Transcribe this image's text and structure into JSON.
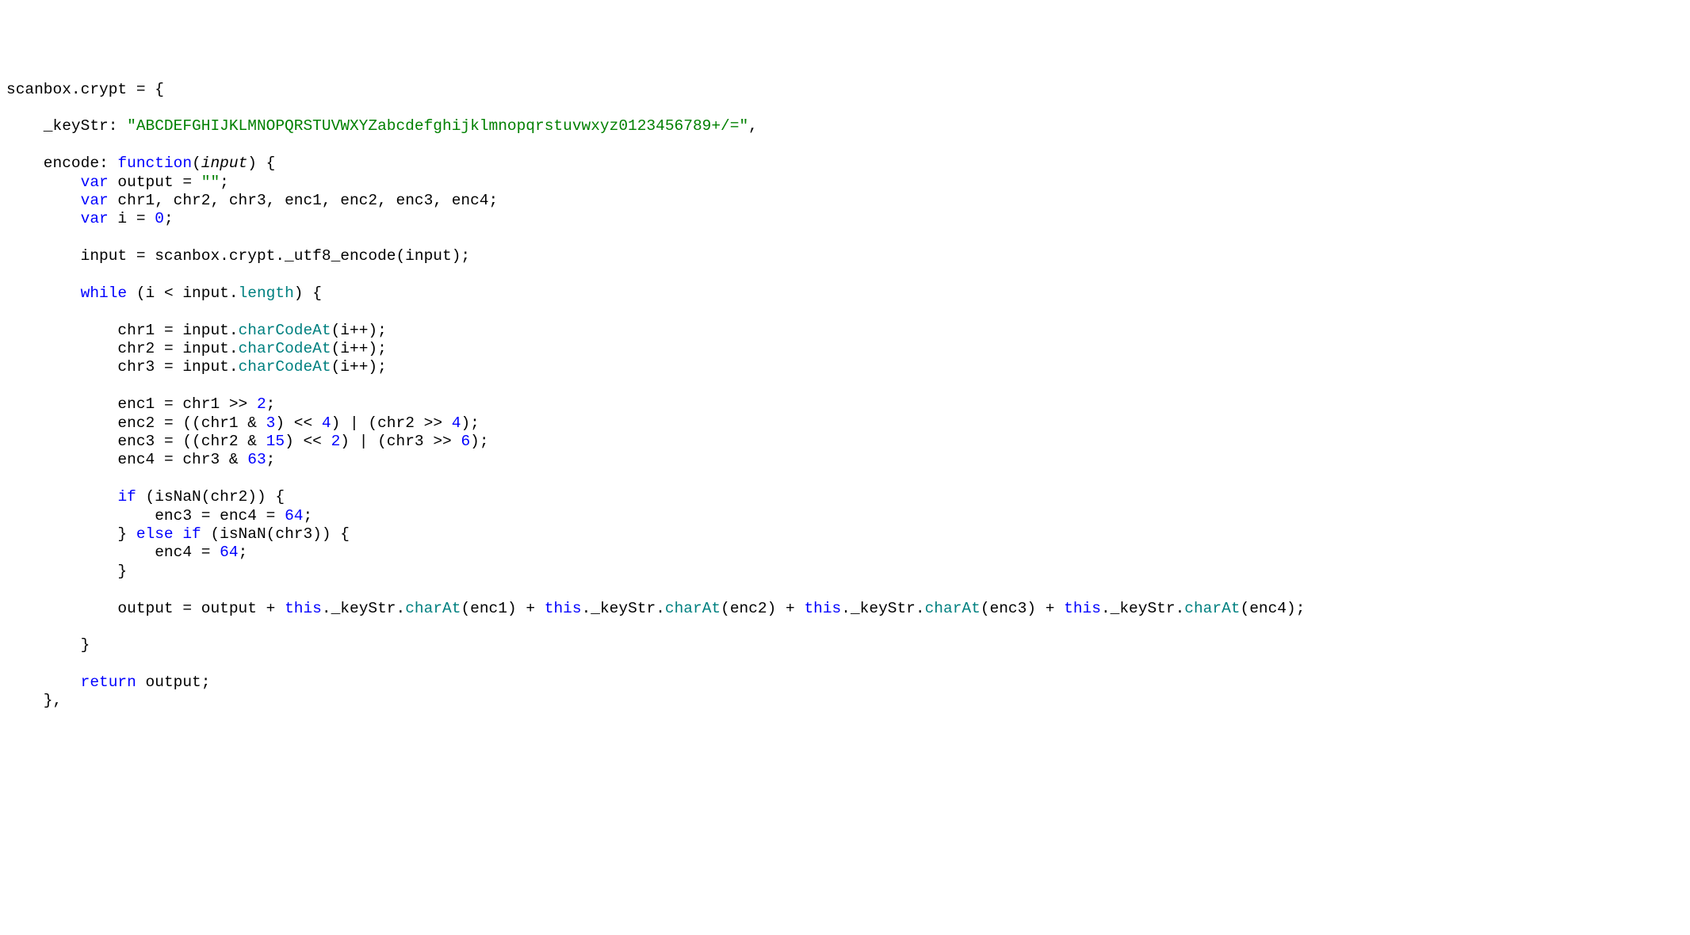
{
  "code": {
    "lines": [
      {
        "tokens": [
          {
            "t": "scanbox.crypt ",
            "c": "identifier"
          },
          {
            "t": "=",
            "c": "operator"
          },
          {
            "t": " {",
            "c": "default"
          }
        ]
      },
      {
        "tokens": [
          {
            "t": "",
            "c": "default"
          }
        ]
      },
      {
        "tokens": [
          {
            "t": "    _keyStr: ",
            "c": "default"
          },
          {
            "t": "\"ABCDEFGHIJKLMNOPQRSTUVWXYZabcdefghijklmnopqrstuvwxyz0123456789+/=\"",
            "c": "string"
          },
          {
            "t": ",",
            "c": "default"
          }
        ]
      },
      {
        "tokens": [
          {
            "t": "",
            "c": "default"
          }
        ]
      },
      {
        "tokens": [
          {
            "t": "    encode: ",
            "c": "default"
          },
          {
            "t": "function",
            "c": "keyword"
          },
          {
            "t": "(",
            "c": "default"
          },
          {
            "t": "input",
            "c": "param"
          },
          {
            "t": ") {",
            "c": "default"
          }
        ]
      },
      {
        "tokens": [
          {
            "t": "        ",
            "c": "default"
          },
          {
            "t": "var",
            "c": "keyword"
          },
          {
            "t": " output ",
            "c": "default"
          },
          {
            "t": "=",
            "c": "operator"
          },
          {
            "t": " ",
            "c": "default"
          },
          {
            "t": "\"\"",
            "c": "string"
          },
          {
            "t": ";",
            "c": "default"
          }
        ]
      },
      {
        "tokens": [
          {
            "t": "        ",
            "c": "default"
          },
          {
            "t": "var",
            "c": "keyword"
          },
          {
            "t": " chr1, chr2, chr3, enc1, enc2, enc3, enc4;",
            "c": "default"
          }
        ]
      },
      {
        "tokens": [
          {
            "t": "        ",
            "c": "default"
          },
          {
            "t": "var",
            "c": "keyword"
          },
          {
            "t": " i ",
            "c": "default"
          },
          {
            "t": "=",
            "c": "operator"
          },
          {
            "t": " ",
            "c": "default"
          },
          {
            "t": "0",
            "c": "number"
          },
          {
            "t": ";",
            "c": "default"
          }
        ]
      },
      {
        "tokens": [
          {
            "t": "",
            "c": "default"
          }
        ]
      },
      {
        "tokens": [
          {
            "t": "        input ",
            "c": "default"
          },
          {
            "t": "=",
            "c": "operator"
          },
          {
            "t": " scanbox.crypt._utf8_encode(input);",
            "c": "default"
          }
        ]
      },
      {
        "tokens": [
          {
            "t": "",
            "c": "default"
          }
        ]
      },
      {
        "tokens": [
          {
            "t": "        ",
            "c": "default"
          },
          {
            "t": "while",
            "c": "keyword"
          },
          {
            "t": " (i ",
            "c": "default"
          },
          {
            "t": "<",
            "c": "operator"
          },
          {
            "t": " input.",
            "c": "default"
          },
          {
            "t": "length",
            "c": "property"
          },
          {
            "t": ") {",
            "c": "default"
          }
        ]
      },
      {
        "tokens": [
          {
            "t": "",
            "c": "default"
          }
        ]
      },
      {
        "tokens": [
          {
            "t": "            chr1 ",
            "c": "default"
          },
          {
            "t": "=",
            "c": "operator"
          },
          {
            "t": " input.",
            "c": "default"
          },
          {
            "t": "charCodeAt",
            "c": "property"
          },
          {
            "t": "(i",
            "c": "default"
          },
          {
            "t": "++",
            "c": "operator"
          },
          {
            "t": ");",
            "c": "default"
          }
        ]
      },
      {
        "tokens": [
          {
            "t": "            chr2 ",
            "c": "default"
          },
          {
            "t": "=",
            "c": "operator"
          },
          {
            "t": " input.",
            "c": "default"
          },
          {
            "t": "charCodeAt",
            "c": "property"
          },
          {
            "t": "(i",
            "c": "default"
          },
          {
            "t": "++",
            "c": "operator"
          },
          {
            "t": ");",
            "c": "default"
          }
        ]
      },
      {
        "tokens": [
          {
            "t": "            chr3 ",
            "c": "default"
          },
          {
            "t": "=",
            "c": "operator"
          },
          {
            "t": " input.",
            "c": "default"
          },
          {
            "t": "charCodeAt",
            "c": "property"
          },
          {
            "t": "(i",
            "c": "default"
          },
          {
            "t": "++",
            "c": "operator"
          },
          {
            "t": ");",
            "c": "default"
          }
        ]
      },
      {
        "tokens": [
          {
            "t": "",
            "c": "default"
          }
        ]
      },
      {
        "tokens": [
          {
            "t": "            enc1 ",
            "c": "default"
          },
          {
            "t": "=",
            "c": "operator"
          },
          {
            "t": " chr1 ",
            "c": "default"
          },
          {
            "t": ">>",
            "c": "operator"
          },
          {
            "t": " ",
            "c": "default"
          },
          {
            "t": "2",
            "c": "number"
          },
          {
            "t": ";",
            "c": "default"
          }
        ]
      },
      {
        "tokens": [
          {
            "t": "            enc2 ",
            "c": "default"
          },
          {
            "t": "=",
            "c": "operator"
          },
          {
            "t": " ((chr1 ",
            "c": "default"
          },
          {
            "t": "&",
            "c": "operator"
          },
          {
            "t": " ",
            "c": "default"
          },
          {
            "t": "3",
            "c": "number"
          },
          {
            "t": ") ",
            "c": "default"
          },
          {
            "t": "<<",
            "c": "operator"
          },
          {
            "t": " ",
            "c": "default"
          },
          {
            "t": "4",
            "c": "number"
          },
          {
            "t": ") ",
            "c": "default"
          },
          {
            "t": "|",
            "c": "operator"
          },
          {
            "t": " (chr2 ",
            "c": "default"
          },
          {
            "t": ">>",
            "c": "operator"
          },
          {
            "t": " ",
            "c": "default"
          },
          {
            "t": "4",
            "c": "number"
          },
          {
            "t": ");",
            "c": "default"
          }
        ]
      },
      {
        "tokens": [
          {
            "t": "            enc3 ",
            "c": "default"
          },
          {
            "t": "=",
            "c": "operator"
          },
          {
            "t": " ((chr2 ",
            "c": "default"
          },
          {
            "t": "&",
            "c": "operator"
          },
          {
            "t": " ",
            "c": "default"
          },
          {
            "t": "15",
            "c": "number"
          },
          {
            "t": ") ",
            "c": "default"
          },
          {
            "t": "<<",
            "c": "operator"
          },
          {
            "t": " ",
            "c": "default"
          },
          {
            "t": "2",
            "c": "number"
          },
          {
            "t": ") ",
            "c": "default"
          },
          {
            "t": "|",
            "c": "operator"
          },
          {
            "t": " (chr3 ",
            "c": "default"
          },
          {
            "t": ">>",
            "c": "operator"
          },
          {
            "t": " ",
            "c": "default"
          },
          {
            "t": "6",
            "c": "number"
          },
          {
            "t": ");",
            "c": "default"
          }
        ]
      },
      {
        "tokens": [
          {
            "t": "            enc4 ",
            "c": "default"
          },
          {
            "t": "=",
            "c": "operator"
          },
          {
            "t": " chr3 ",
            "c": "default"
          },
          {
            "t": "&",
            "c": "operator"
          },
          {
            "t": " ",
            "c": "default"
          },
          {
            "t": "63",
            "c": "number"
          },
          {
            "t": ";",
            "c": "default"
          }
        ]
      },
      {
        "tokens": [
          {
            "t": "",
            "c": "default"
          }
        ]
      },
      {
        "tokens": [
          {
            "t": "            ",
            "c": "default"
          },
          {
            "t": "if",
            "c": "keyword"
          },
          {
            "t": " (isNaN(chr2)) {",
            "c": "default"
          }
        ]
      },
      {
        "tokens": [
          {
            "t": "                enc3 ",
            "c": "default"
          },
          {
            "t": "=",
            "c": "operator"
          },
          {
            "t": " enc4 ",
            "c": "default"
          },
          {
            "t": "=",
            "c": "operator"
          },
          {
            "t": " ",
            "c": "default"
          },
          {
            "t": "64",
            "c": "number"
          },
          {
            "t": ";",
            "c": "default"
          }
        ]
      },
      {
        "tokens": [
          {
            "t": "            } ",
            "c": "default"
          },
          {
            "t": "else",
            "c": "keyword"
          },
          {
            "t": " ",
            "c": "default"
          },
          {
            "t": "if",
            "c": "keyword"
          },
          {
            "t": " (isNaN(chr3)) {",
            "c": "default"
          }
        ]
      },
      {
        "tokens": [
          {
            "t": "                enc4 ",
            "c": "default"
          },
          {
            "t": "=",
            "c": "operator"
          },
          {
            "t": " ",
            "c": "default"
          },
          {
            "t": "64",
            "c": "number"
          },
          {
            "t": ";",
            "c": "default"
          }
        ]
      },
      {
        "tokens": [
          {
            "t": "            }",
            "c": "default"
          }
        ]
      },
      {
        "tokens": [
          {
            "t": "",
            "c": "default"
          }
        ]
      },
      {
        "tokens": [
          {
            "t": "            output ",
            "c": "default"
          },
          {
            "t": "=",
            "c": "operator"
          },
          {
            "t": " output ",
            "c": "default"
          },
          {
            "t": "+",
            "c": "operator"
          },
          {
            "t": " ",
            "c": "default"
          },
          {
            "t": "this",
            "c": "keyword"
          },
          {
            "t": "._keyStr.",
            "c": "default"
          },
          {
            "t": "charAt",
            "c": "property"
          },
          {
            "t": "(enc1) ",
            "c": "default"
          },
          {
            "t": "+",
            "c": "operator"
          },
          {
            "t": " ",
            "c": "default"
          },
          {
            "t": "this",
            "c": "keyword"
          },
          {
            "t": "._keyStr.",
            "c": "default"
          },
          {
            "t": "charAt",
            "c": "property"
          },
          {
            "t": "(enc2) ",
            "c": "default"
          },
          {
            "t": "+",
            "c": "operator"
          },
          {
            "t": " ",
            "c": "default"
          },
          {
            "t": "this",
            "c": "keyword"
          },
          {
            "t": "._keyStr.",
            "c": "default"
          },
          {
            "t": "charAt",
            "c": "property"
          },
          {
            "t": "(enc3) ",
            "c": "default"
          },
          {
            "t": "+",
            "c": "operator"
          },
          {
            "t": " ",
            "c": "default"
          },
          {
            "t": "this",
            "c": "keyword"
          },
          {
            "t": "._keyStr.",
            "c": "default"
          },
          {
            "t": "charAt",
            "c": "property"
          },
          {
            "t": "(enc4);",
            "c": "default"
          }
        ]
      },
      {
        "tokens": [
          {
            "t": "",
            "c": "default"
          }
        ]
      },
      {
        "tokens": [
          {
            "t": "        }",
            "c": "default"
          }
        ]
      },
      {
        "tokens": [
          {
            "t": "",
            "c": "default"
          }
        ]
      },
      {
        "tokens": [
          {
            "t": "        ",
            "c": "default"
          },
          {
            "t": "return",
            "c": "keyword"
          },
          {
            "t": " output;",
            "c": "default"
          }
        ]
      },
      {
        "tokens": [
          {
            "t": "    },",
            "c": "default"
          }
        ]
      }
    ]
  }
}
